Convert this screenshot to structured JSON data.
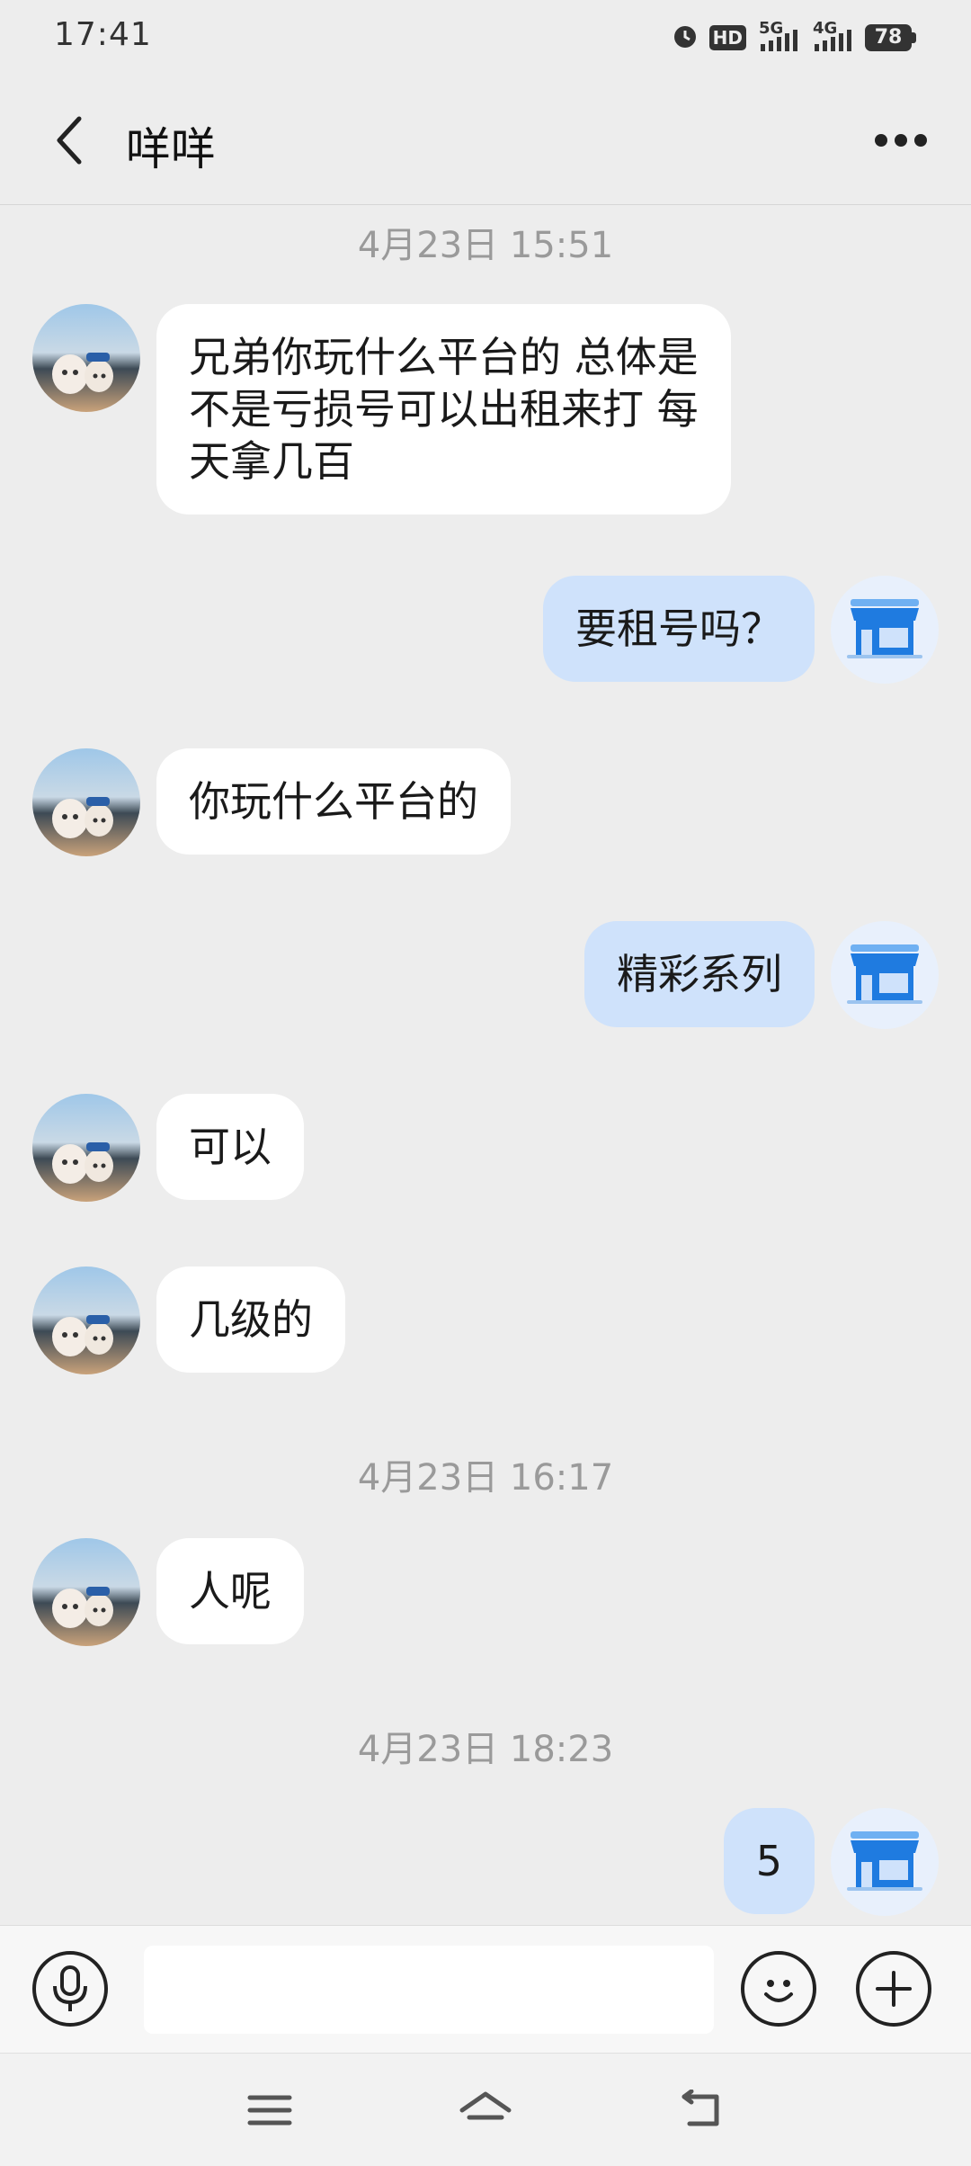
{
  "status_bar": {
    "time": "17:41",
    "hd_label": "HD",
    "net1": "5G",
    "net2": "4G",
    "battery": "78",
    "icons": [
      "alarm-icon",
      "hd-icon",
      "signal-5g-icon",
      "signal-4g-icon",
      "battery-icon"
    ]
  },
  "header": {
    "title": "咩咩",
    "back_icon": "chevron-left-icon",
    "more_icon": "more-dots-icon"
  },
  "messages": {
    "ts1": "4月23日 15:51",
    "m1": "兄弟你玩什么平台的 总体是\n不是亏损号可以出租来打 每\n天拿几百",
    "m2": "要租号吗？",
    "m3": "你玩什么平台的",
    "m4": "精彩系列",
    "m5": "可以",
    "m6": "几级的",
    "ts2": "4月23日 16:17",
    "m7": "人呢",
    "ts3": "4月23日 18:23",
    "m8": "5"
  },
  "input_bar": {
    "voice_icon": "microphone-icon",
    "emoji_icon": "emoji-icon",
    "plus_icon": "plus-icon",
    "placeholder": ""
  },
  "nav_bar": {
    "icons": [
      "menu-icon",
      "home-icon",
      "back-icon"
    ]
  },
  "colors": {
    "background": "#ededed",
    "bubble_left": "#ffffff",
    "bubble_right": "#cfe2fb",
    "accent_blue": "#1f7be0"
  }
}
